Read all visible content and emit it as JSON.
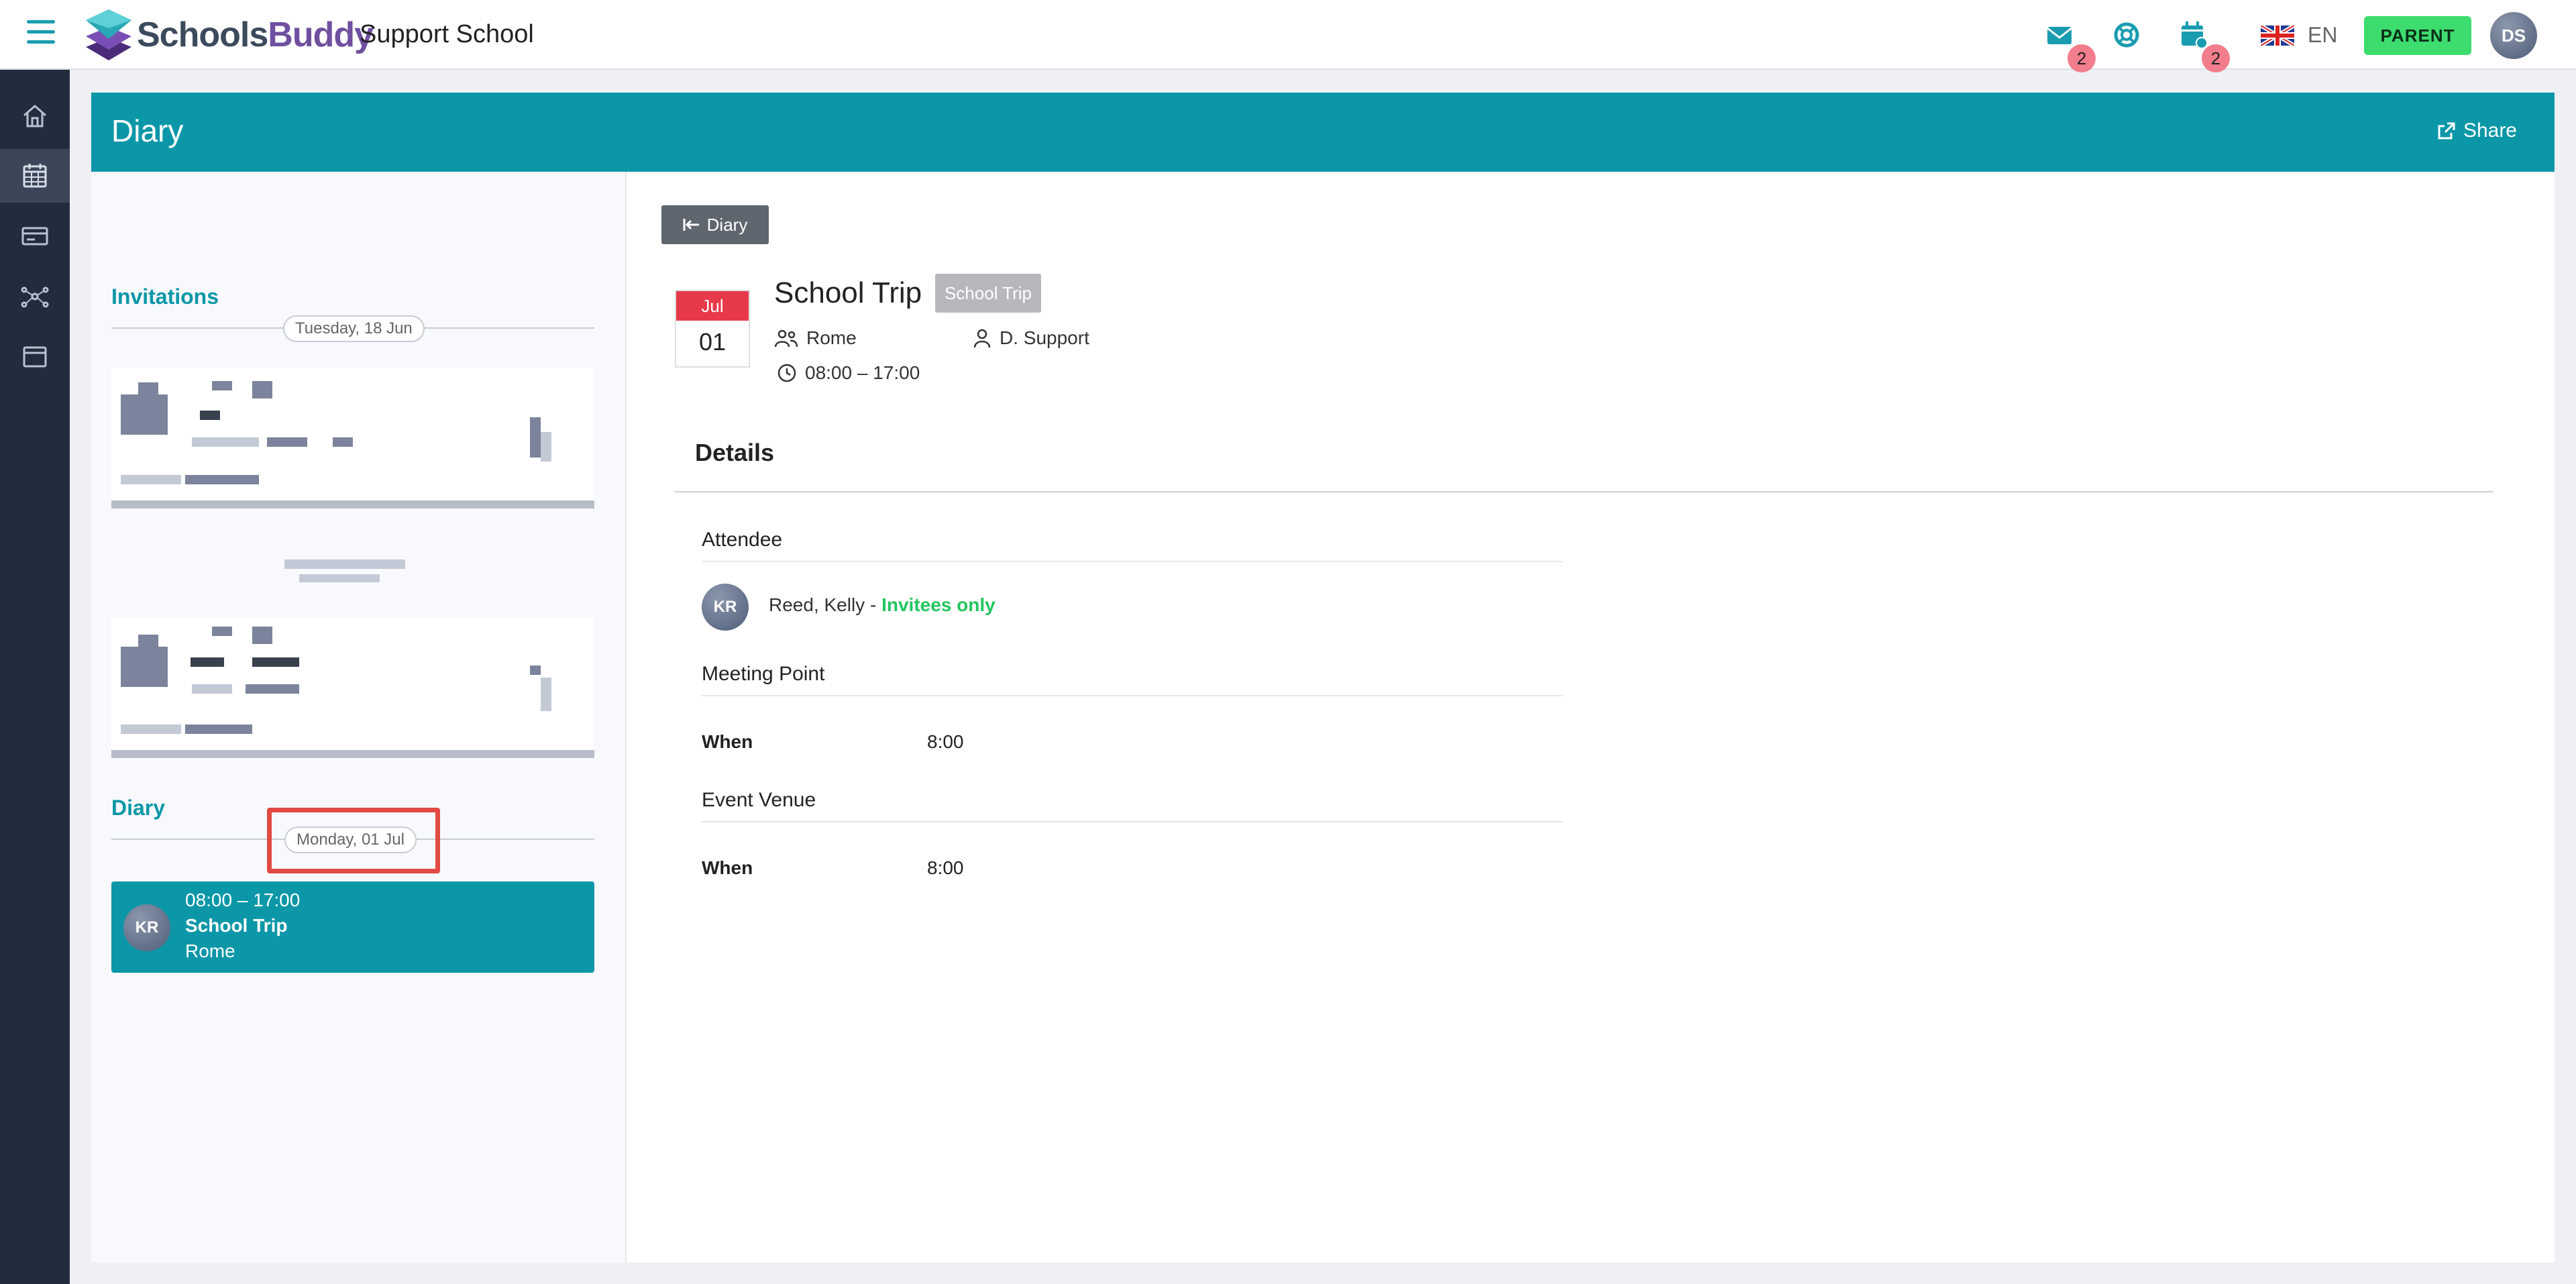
{
  "app": {
    "brand_part1": "Schools",
    "brand_part2": "Buddy",
    "school_name": "Support School"
  },
  "topbar": {
    "messages_badge": "2",
    "events_badge": "2",
    "language": "EN",
    "role_button": "PARENT",
    "user_initials": "DS"
  },
  "page": {
    "title": "Diary",
    "share_label": "Share"
  },
  "left_panel": {
    "invitations_title": "Invitations",
    "invitations_date": "Tuesday, 18 Jun",
    "diary_title": "Diary",
    "diary_date": "Monday, 01 Jul",
    "diary_event": {
      "initials": "KR",
      "time": "08:00 – 17:00",
      "title": "School Trip",
      "location": "Rome"
    }
  },
  "detail": {
    "back_label": "Diary",
    "month": "Jul",
    "day": "01",
    "title": "School Trip",
    "tag": "School Trip",
    "location": "Rome",
    "organizer": "D. Support",
    "time": "08:00 – 17:00",
    "details_heading": "Details",
    "attendee_heading": "Attendee",
    "attendee_initials": "KR",
    "attendee_name": "Reed, Kelly - ",
    "attendee_status": "Invitees only",
    "meeting_point_heading": "Meeting Point",
    "meeting_when_label": "When",
    "meeting_when_value": "8:00",
    "venue_heading": "Event Venue",
    "venue_when_label": "When",
    "venue_when_value": "8:00"
  },
  "colors": {
    "accent": "#0b97a8",
    "nav_bg": "#222c3c",
    "role_button": "#3ddc6f",
    "calendar_month": "#e8394a",
    "invitees_status": "#22c55e",
    "highlight_box": "#e14b43"
  },
  "icons": [
    "menu-icon",
    "logo-icon",
    "mail-icon",
    "lifebuoy-icon",
    "calendar-user-icon",
    "uk-flag-icon",
    "home-icon",
    "calendar-icon",
    "card-icon",
    "network-icon",
    "window-icon",
    "share-icon",
    "back-arrow-icon",
    "group-icon",
    "person-icon",
    "clock-icon"
  ]
}
